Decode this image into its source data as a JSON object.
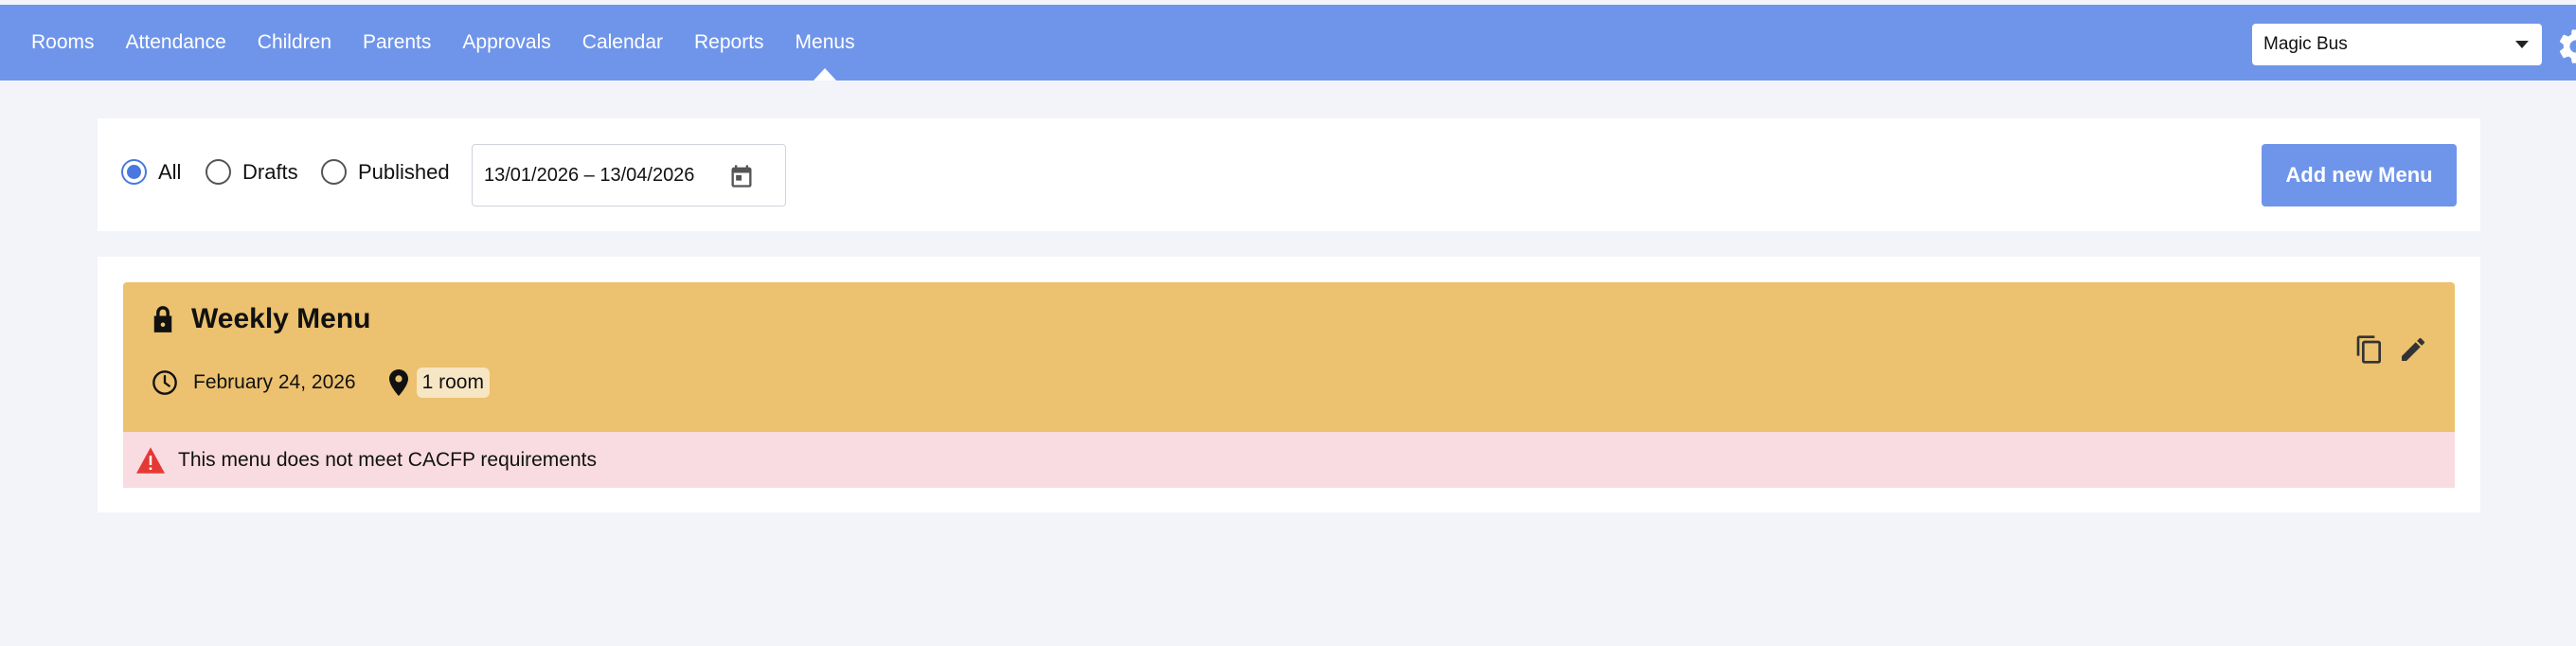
{
  "nav": {
    "items": [
      {
        "label": "Rooms",
        "active": false
      },
      {
        "label": "Attendance",
        "active": false
      },
      {
        "label": "Children",
        "active": false
      },
      {
        "label": "Parents",
        "active": false
      },
      {
        "label": "Approvals",
        "active": false
      },
      {
        "label": "Calendar",
        "active": false
      },
      {
        "label": "Reports",
        "active": false
      },
      {
        "label": "Menus",
        "active": true
      }
    ],
    "center_select": {
      "value": "Magic Bus",
      "icon": "chevron-down-icon"
    },
    "settings_icon": "gear-icon"
  },
  "filters": {
    "radios": [
      {
        "label": "All",
        "checked": true
      },
      {
        "label": "Drafts",
        "checked": false
      },
      {
        "label": "Published",
        "checked": false
      }
    ],
    "date_range": "13/01/2026 – 13/04/2026",
    "date_icon": "calendar-icon",
    "add_button": "Add new Menu"
  },
  "menus": [
    {
      "title": "Weekly Menu",
      "locked": true,
      "date": "February 24, 2026",
      "rooms": "1 room",
      "warning": "This menu does not meet CACFP requirements",
      "actions": [
        "copy-icon",
        "edit-icon"
      ]
    }
  ],
  "colors": {
    "nav_bg": "#6f95ea",
    "page_bg": "#f3f4f9",
    "card_bg": "#ecc16f",
    "warning_bg": "#f8dce1",
    "warning_icon": "#e53935",
    "radio_accent": "#4a78e0"
  }
}
